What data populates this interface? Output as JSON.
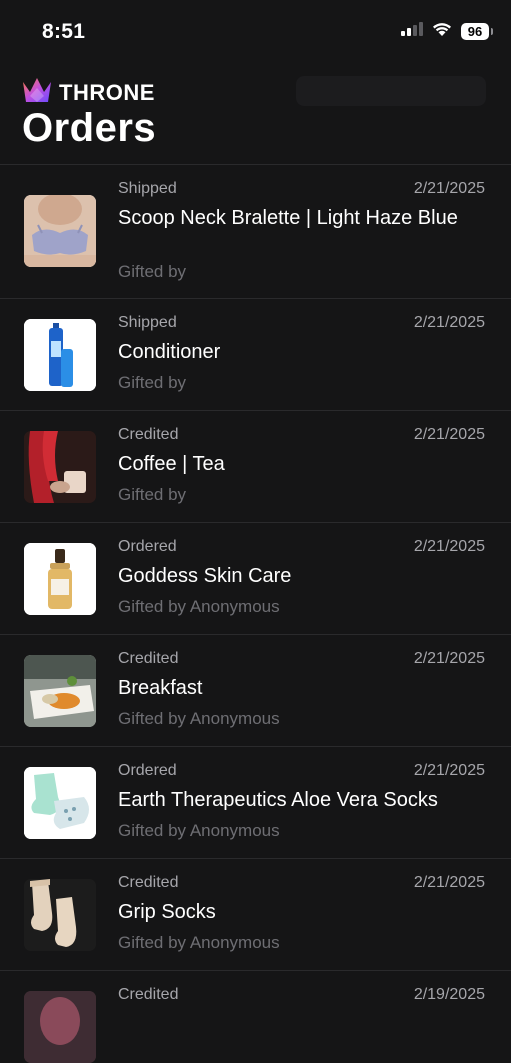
{
  "status_bar": {
    "time": "8:51",
    "battery": "96"
  },
  "header": {
    "brand": "THRONE",
    "title": "Orders"
  },
  "orders": [
    {
      "status": "Shipped",
      "date": "2/21/2025",
      "title": "Scoop Neck Bralette | Light Haze Blue",
      "gifted_by": "Gifted by",
      "gifter": ""
    },
    {
      "status": "Shipped",
      "date": "2/21/2025",
      "title": "Conditioner",
      "gifted_by": "Gifted by",
      "gifter": ""
    },
    {
      "status": "Credited",
      "date": "2/21/2025",
      "title": "Coffee | Tea",
      "gifted_by": "Gifted by",
      "gifter": ""
    },
    {
      "status": "Ordered",
      "date": "2/21/2025",
      "title": "Goddess Skin Care",
      "gifted_by": "Gifted by",
      "gifter": "Anonymous"
    },
    {
      "status": "Credited",
      "date": "2/21/2025",
      "title": "Breakfast",
      "gifted_by": "Gifted by",
      "gifter": "Anonymous"
    },
    {
      "status": "Ordered",
      "date": "2/21/2025",
      "title": "Earth Therapeutics Aloe Vera Socks",
      "gifted_by": "Gifted by",
      "gifter": "Anonymous"
    },
    {
      "status": "Credited",
      "date": "2/21/2025",
      "title": "Grip Socks",
      "gifted_by": "Gifted by",
      "gifter": "Anonymous"
    },
    {
      "status": "Credited",
      "date": "2/19/2025",
      "title": "",
      "gifted_by": "",
      "gifter": ""
    }
  ]
}
